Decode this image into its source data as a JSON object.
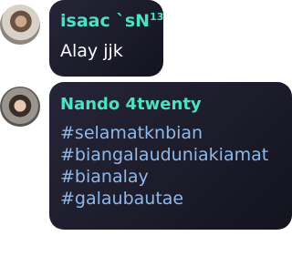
{
  "messages": [
    {
      "sender": "isaac `sN",
      "sender_badge": "13",
      "text": "Alay jjk"
    },
    {
      "sender": "Nando 4twenty",
      "hashtags": [
        "#selamatknbian",
        "#biangalauduniakiamat",
        "#bianalay",
        "#galaubautae"
      ]
    }
  ],
  "colors": {
    "bubble_bg": "#1c1c2b",
    "sender_name": "#4fe0c4",
    "message_text": "#ffffff",
    "hashtag": "#8fb9ea"
  }
}
